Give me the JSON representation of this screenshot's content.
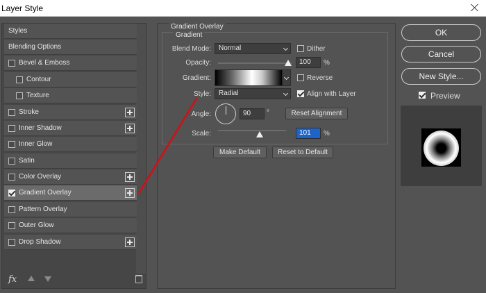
{
  "window": {
    "title": "Layer Style"
  },
  "styles_list": {
    "items": [
      {
        "label": "Styles",
        "checkbox": false,
        "checked": false,
        "plus": false,
        "indent": false,
        "active": false
      },
      {
        "label": "Blending Options",
        "checkbox": false,
        "checked": false,
        "plus": false,
        "indent": false,
        "active": false
      },
      {
        "label": "Bevel & Emboss",
        "checkbox": true,
        "checked": false,
        "plus": false,
        "indent": false,
        "active": false
      },
      {
        "label": "Contour",
        "checkbox": true,
        "checked": false,
        "plus": false,
        "indent": true,
        "active": false
      },
      {
        "label": "Texture",
        "checkbox": true,
        "checked": false,
        "plus": false,
        "indent": true,
        "active": false
      },
      {
        "label": "Stroke",
        "checkbox": true,
        "checked": false,
        "plus": true,
        "indent": false,
        "active": false
      },
      {
        "label": "Inner Shadow",
        "checkbox": true,
        "checked": false,
        "plus": true,
        "indent": false,
        "active": false
      },
      {
        "label": "Inner Glow",
        "checkbox": true,
        "checked": false,
        "plus": false,
        "indent": false,
        "active": false
      },
      {
        "label": "Satin",
        "checkbox": true,
        "checked": false,
        "plus": false,
        "indent": false,
        "active": false
      },
      {
        "label": "Color Overlay",
        "checkbox": true,
        "checked": false,
        "plus": true,
        "indent": false,
        "active": false
      },
      {
        "label": "Gradient Overlay",
        "checkbox": true,
        "checked": true,
        "plus": true,
        "indent": false,
        "active": true
      },
      {
        "label": "Pattern Overlay",
        "checkbox": true,
        "checked": false,
        "plus": false,
        "indent": false,
        "active": false
      },
      {
        "label": "Outer Glow",
        "checkbox": true,
        "checked": false,
        "plus": false,
        "indent": false,
        "active": false
      },
      {
        "label": "Drop Shadow",
        "checkbox": true,
        "checked": false,
        "plus": true,
        "indent": false,
        "active": false
      }
    ],
    "fx_label": "fx"
  },
  "gradient_overlay": {
    "section_title": "Gradient Overlay",
    "group_title": "Gradient",
    "blend_mode_label": "Blend Mode:",
    "blend_mode_value": "Normal",
    "dither_label": "Dither",
    "dither_checked": false,
    "opacity_label": "Opacity:",
    "opacity_value": "100",
    "opacity_unit": "%",
    "opacity_fraction": 1.0,
    "gradient_label": "Gradient:",
    "reverse_label": "Reverse",
    "reverse_checked": false,
    "style_label": "Style:",
    "style_value": "Radial",
    "align_label": "Align with Layer",
    "align_checked": true,
    "angle_label": "Angle:",
    "angle_value": "90",
    "angle_unit": "°",
    "reset_alignment_label": "Reset Alignment",
    "scale_label": "Scale:",
    "scale_value": "101",
    "scale_unit": "%",
    "make_default_label": "Make Default",
    "reset_default_label": "Reset to Default"
  },
  "right_panel": {
    "ok_label": "OK",
    "cancel_label": "Cancel",
    "new_style_label": "New Style...",
    "preview_label": "Preview",
    "preview_checked": true
  },
  "colors": {
    "background": "#535353",
    "annotation_line": "#c0181e",
    "highlight_field": "#1e64c8"
  }
}
